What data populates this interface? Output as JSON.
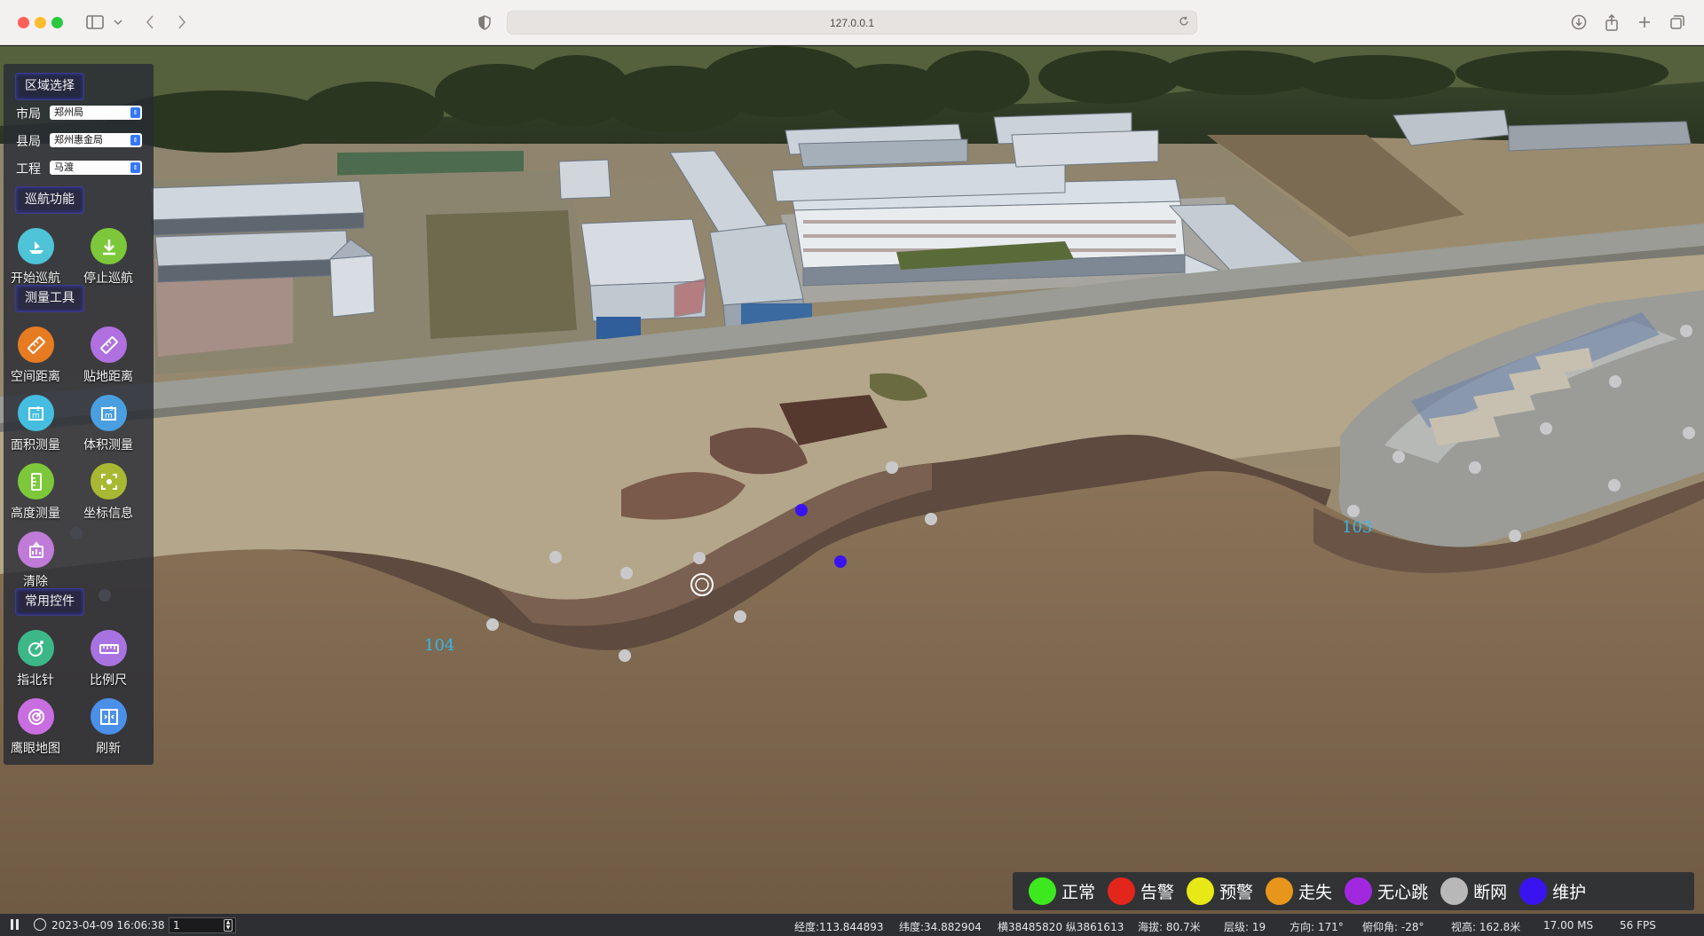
{
  "browser": {
    "url": "127.0.0.1"
  },
  "panel": {
    "region_title": "区域选择",
    "selects": [
      {
        "label": "市局",
        "value": "郑州局"
      },
      {
        "label": "县局",
        "value": "郑州惠金局"
      },
      {
        "label": "工程",
        "value": "马渡"
      }
    ],
    "cruise_title": "巡航功能",
    "cruise_tools": [
      {
        "label": "开始巡航",
        "icon": "start-cruise-icon",
        "color": "#4fc3d8"
      },
      {
        "label": "停止巡航",
        "icon": "stop-cruise-icon",
        "color": "#7cc83a"
      }
    ],
    "measure_title": "测量工具",
    "measure_tools": [
      {
        "label": "空间距离",
        "icon": "ruler-icon",
        "color": "#e77b22"
      },
      {
        "label": "贴地距离",
        "icon": "ground-ruler-icon",
        "color": "#b070e0"
      },
      {
        "label": "面积测量",
        "icon": "area-icon",
        "color": "#45bde0"
      },
      {
        "label": "体积测量",
        "icon": "volume-icon",
        "color": "#4a9fe0"
      },
      {
        "label": "高度测量",
        "icon": "height-icon",
        "color": "#7cc83a"
      },
      {
        "label": "坐标信息",
        "icon": "coordinate-icon",
        "color": "#a8b832"
      },
      {
        "label": "清除",
        "icon": "clear-icon",
        "color": "#c07ad8"
      }
    ],
    "common_title": "常用控件",
    "common_tools": [
      {
        "label": "指北针",
        "icon": "compass-icon",
        "color": "#3cb888"
      },
      {
        "label": "比例尺",
        "icon": "scale-bar-icon",
        "color": "#a873e0"
      },
      {
        "label": "鹰眼地图",
        "icon": "eagle-eye-icon",
        "color": "#c86ee0"
      },
      {
        "label": "刷新",
        "icon": "refresh-icon",
        "color": "#4a8fe8"
      }
    ]
  },
  "scene": {
    "labels": [
      {
        "text": "104"
      },
      {
        "text": "103"
      }
    ]
  },
  "legend": [
    {
      "label": "正常",
      "color": "#3ee81e"
    },
    {
      "label": "告警",
      "color": "#e3261b"
    },
    {
      "label": "预警",
      "color": "#e8e817"
    },
    {
      "label": "走失",
      "color": "#e8961b"
    },
    {
      "label": "无心跳",
      "color": "#a228e0"
    },
    {
      "label": "断网",
      "color": "#b8b8b8"
    },
    {
      "label": "维护",
      "color": "#3a14f0"
    }
  ],
  "status": {
    "datetime": "2023-04-09 16:06:38",
    "speed": "1",
    "longitude": "经度:113.844893",
    "latitude": "纬度:34.882904",
    "grid": "横38485820 纵3861613",
    "altitude": "海拔:  80.7米",
    "level": "层级:  19",
    "heading": "方向:  171°",
    "pitch": "俯仰角:  -28°",
    "view_height": "视高:  162.8米",
    "frame_time": "17.00 MS",
    "fps": "56 FPS"
  }
}
